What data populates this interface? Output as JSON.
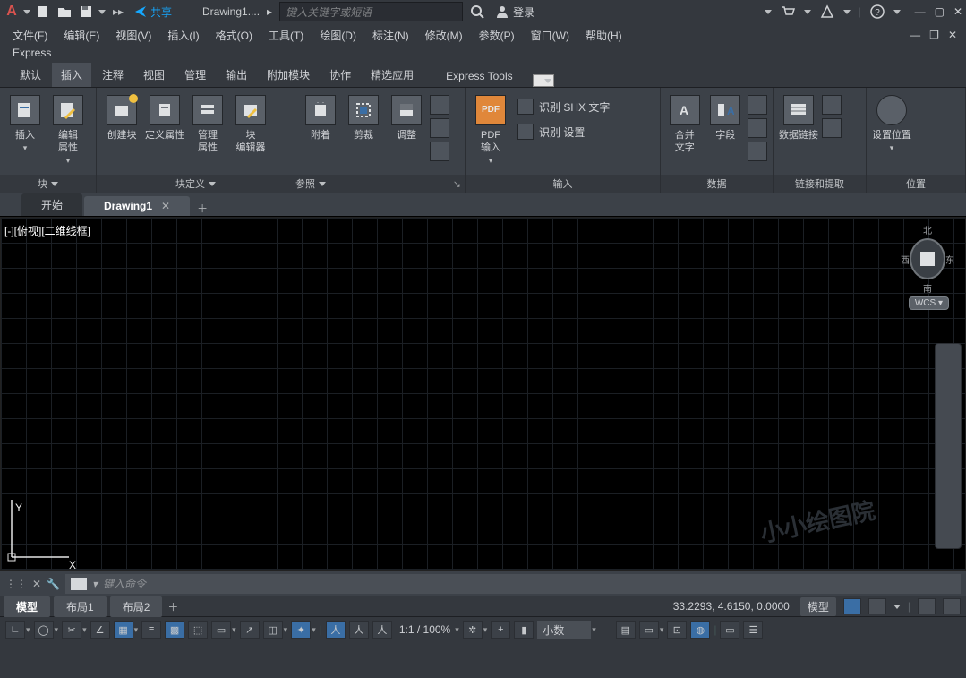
{
  "title": {
    "share": "共享",
    "doc": "Drawing1....",
    "search_ph": "键入关键字或短语",
    "login": "登录"
  },
  "menubar": [
    "文件(F)",
    "编辑(E)",
    "视图(V)",
    "插入(I)",
    "格式(O)",
    "工具(T)",
    "绘图(D)",
    "标注(N)",
    "修改(M)",
    "参数(P)",
    "窗口(W)",
    "帮助(H)"
  ],
  "express": "Express",
  "ribbon_tabs": [
    "默认",
    "插入",
    "注释",
    "视图",
    "管理",
    "输出",
    "附加模块",
    "协作",
    "精选应用",
    "Express Tools"
  ],
  "ribbon_tabs_active": 1,
  "panels": {
    "block": {
      "insert": "插入",
      "edit_attr": "编辑\n属性",
      "foot": "块"
    },
    "blockdef": {
      "create": "创建块",
      "defattr": "定义属性",
      "mgmt": "管理\n属性",
      "editor": "块\n编辑器",
      "foot": "块定义"
    },
    "ref": {
      "attach": "附着",
      "crop": "剪裁",
      "adjust": "调整",
      "foot": "参照"
    },
    "import": {
      "pdf": "PDF\n输入",
      "shx": "识别 SHX 文字",
      "setting": "识别 设置",
      "foot": "输入"
    },
    "merge": {
      "merge": "合并\n文字",
      "field": "字段"
    },
    "data": {
      "link": "数据链接",
      "foot": "数据"
    },
    "linkext": {
      "foot": "链接和提取"
    },
    "location": {
      "set": "设置位置",
      "foot": "位置"
    }
  },
  "doc_tabs": {
    "start": "开始",
    "drawing": "Drawing1"
  },
  "viewport": {
    "label": "[-][俯视][二维线框]",
    "wcs": "WCS",
    "watermark": "小小绘图院",
    "compass": {
      "n": "北",
      "s": "南",
      "e": "东",
      "w": "西"
    }
  },
  "cmd": {
    "ph": "键入命令"
  },
  "layout_tabs": [
    "模型",
    "布局1",
    "布局2"
  ],
  "status": {
    "coords": "33.2293, 4.6150, 0.0000",
    "mode": "模型"
  },
  "status2": {
    "scale": "1:1 / 100%",
    "units": "小数"
  }
}
